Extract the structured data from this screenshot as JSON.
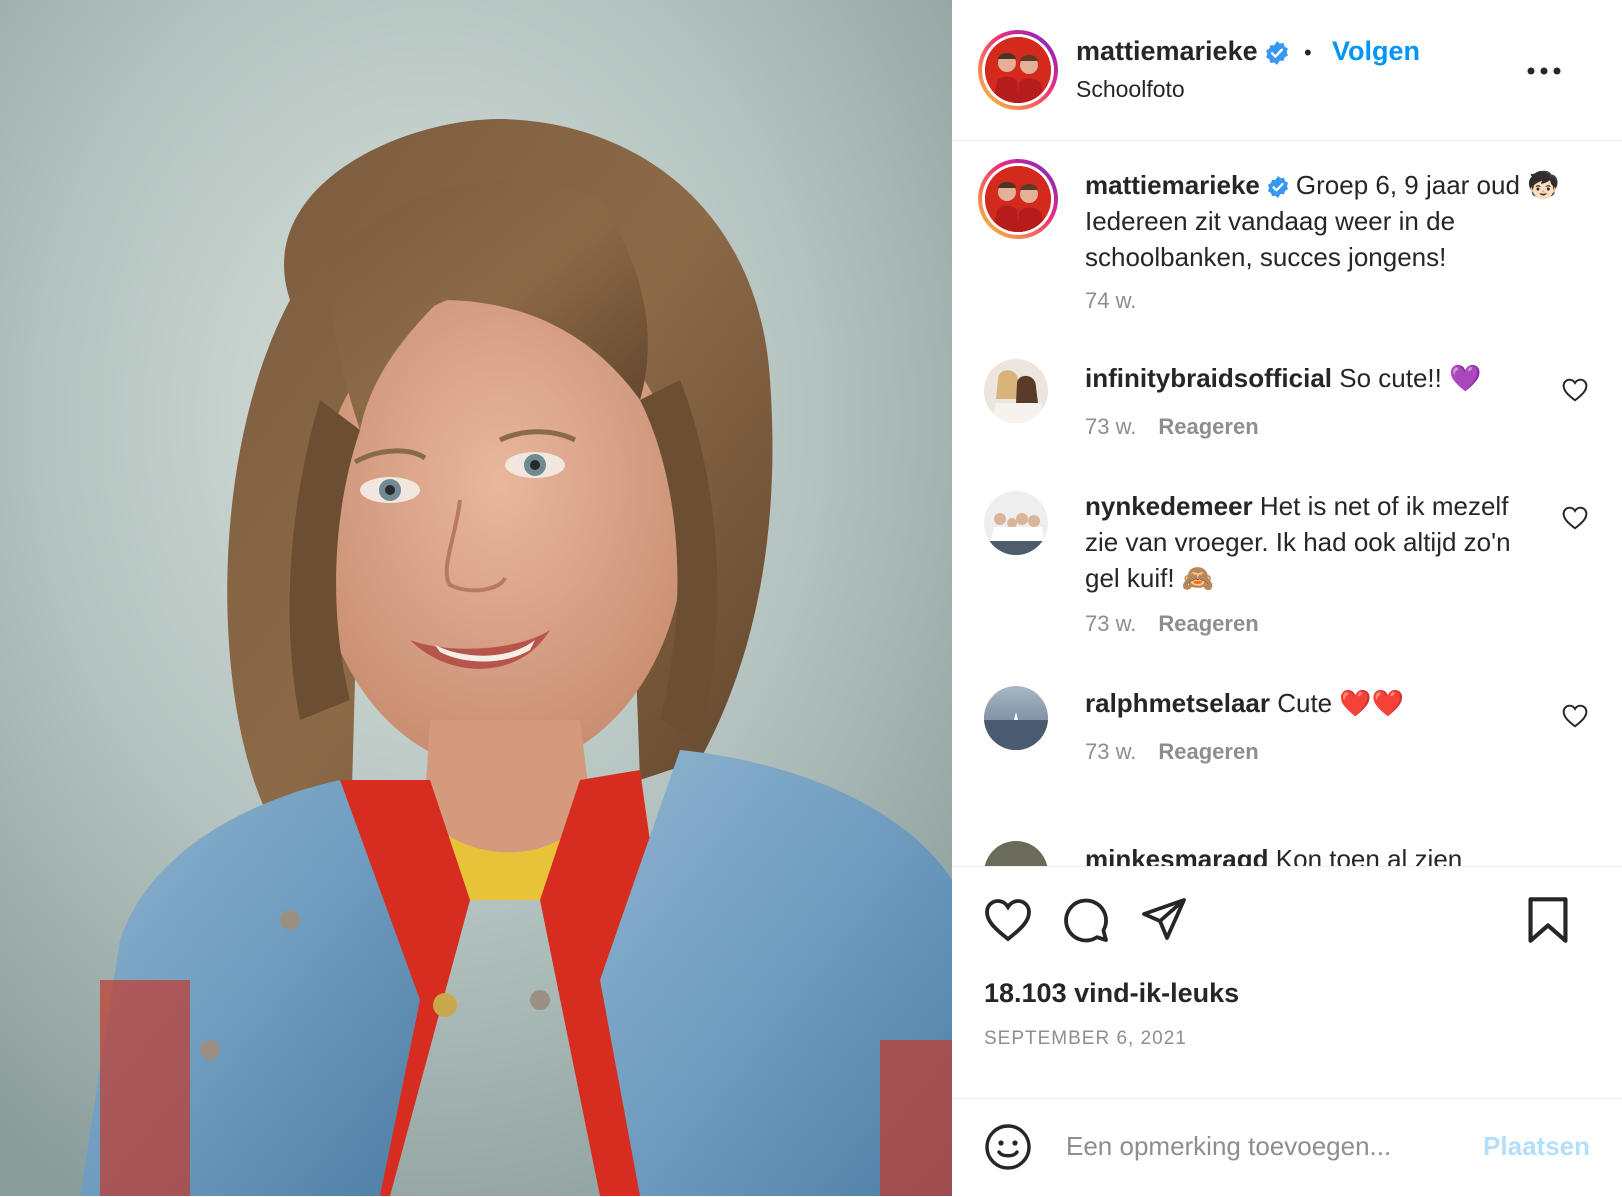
{
  "post": {
    "image_alt": "Schoolfoto",
    "header": {
      "username": "mattiemarieke",
      "separator": "•",
      "follow_label": "Volgen",
      "location": "Schoolfoto",
      "more_label": "•••"
    },
    "caption": {
      "username": "mattiemarieke",
      "text": "Groep 6, 9 jaar oud 🧒🏻 Iedereen zit vandaag weer in de schoolbanken, succes jongens!",
      "time": "74 w."
    },
    "comments": [
      {
        "username": "infinitybraidsofficial",
        "text": "So cute!! 💜",
        "time": "73 w.",
        "reply_label": "Reageren"
      },
      {
        "username": "nynkedemeer",
        "text": "Het is net of ik mezelf zie van vroeger. Ik had ook altijd zo'n gel kuif! 🙈",
        "time": "73 w.",
        "reply_label": "Reageren"
      },
      {
        "username": "ralphmetselaar",
        "text": "Cute ❤️❤️",
        "time": "73 w.",
        "reply_label": "Reageren"
      },
      {
        "username": "minkesmaragd",
        "text": "Kon toen al zien",
        "time": "",
        "reply_label": ""
      }
    ],
    "likes": "18.103 vind-ik-leuks",
    "date": "SEPTEMBER 6, 2021",
    "add_comment": {
      "placeholder": "Een opmerking toevoegen...",
      "post_label": "Plaatsen"
    },
    "colors": {
      "link_blue": "#0095f6",
      "post_disabled": "#b2dffc",
      "meta_gray": "#8e8e8e",
      "verified_blue": "#3897f0"
    }
  }
}
